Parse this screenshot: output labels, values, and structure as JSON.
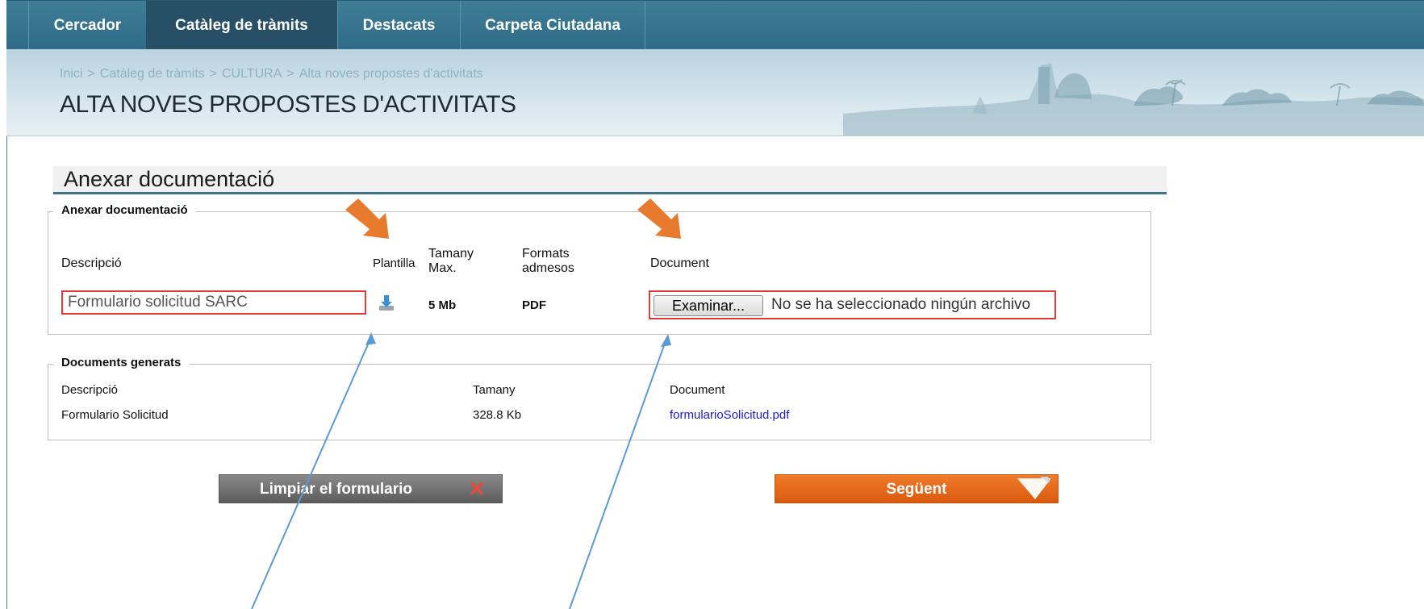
{
  "nav": {
    "tabs": [
      {
        "label": "Cercador"
      },
      {
        "label": "Catàleg de tràmits"
      },
      {
        "label": "Destacats"
      },
      {
        "label": "Carpeta Ciutadana"
      }
    ]
  },
  "breadcrumb": [
    "Inici",
    "Catàleg de tràmits",
    "CULTURA",
    "Alta noves propostes d'activitats"
  ],
  "breadcrumb_separator": ">",
  "page_title": "ALTA NOVES PROPOSTES D'ACTIVITATS",
  "section_title": "Anexar documentació",
  "attach": {
    "legend": "Anexar documentació",
    "headers": {
      "description": "Descripció",
      "template": "Plantilla",
      "max_size": "Tamany Max.",
      "formats": "Formats admesos",
      "document": "Document"
    },
    "row": {
      "description": "Formulario solicitud SARC",
      "template_icon": "download-icon",
      "max_size": "5 Mb",
      "formats": "PDF",
      "browse_label": "Examinar...",
      "file_status": "No se ha seleccionado ningún archivo"
    }
  },
  "generated": {
    "legend": "Documents generats",
    "headers": {
      "description": "Descripció",
      "size": "Tamany",
      "document": "Document"
    },
    "row": {
      "description": "Formulario Solicitud",
      "size": "328.8 Kb",
      "document": "formularioSolicitud.pdf"
    }
  },
  "buttons": {
    "clear": "Limpiar el formulario",
    "next": "Següent"
  },
  "colors": {
    "nav": "#2f6b86",
    "accent_orange": "#e87a2e",
    "highlight_red": "#e03b3b",
    "annotation_blue": "#5b9bd5"
  }
}
